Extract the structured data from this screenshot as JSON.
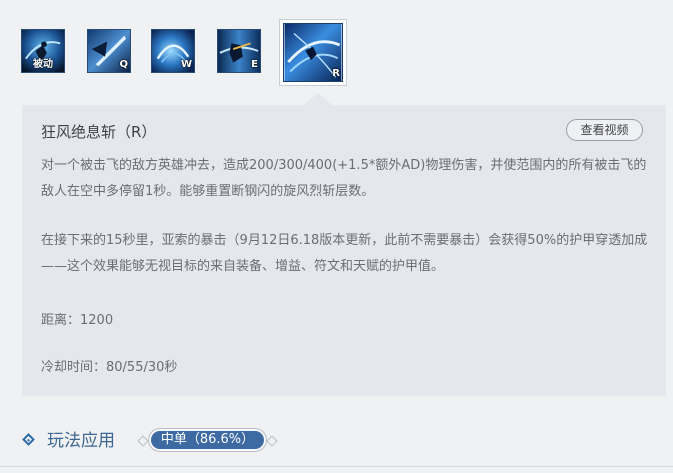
{
  "skills": [
    {
      "key": "被动",
      "icon": "passive-skill-icon"
    },
    {
      "key": "Q",
      "icon": "q-skill-icon"
    },
    {
      "key": "W",
      "icon": "w-skill-icon"
    },
    {
      "key": "E",
      "icon": "e-skill-icon"
    },
    {
      "key": "R",
      "icon": "r-skill-icon",
      "selected": true
    }
  ],
  "detail": {
    "title": "狂风绝息斩（R）",
    "video_button": "查看视频",
    "desc1": "对一个被击飞的敌方英雄冲去，造成200/300/400(+1.5*额外AD)物理伤害，并使范围内的所有被击飞的敌人在空中多停留1秒。能够重置断钢闪的旋风烈斩层数。",
    "desc2": "在接下来的15秒里，亚索的暴击（9月12日6.18版本更新，此前不需要暴击）会获得50%的护甲穿透加成——这个效果能够无视目标的来自装备、增益、符文和天赋的护甲值。",
    "range": "距离：1200",
    "cooldown": "冷却时间：80/55/30秒"
  },
  "usage": {
    "title": "玩法应用",
    "tag": "中单（86.6%）"
  },
  "colors": {
    "panel_bg": "#e4e7ec",
    "accent": "#3d6aa3",
    "page_bg": "#f0f1f3"
  }
}
